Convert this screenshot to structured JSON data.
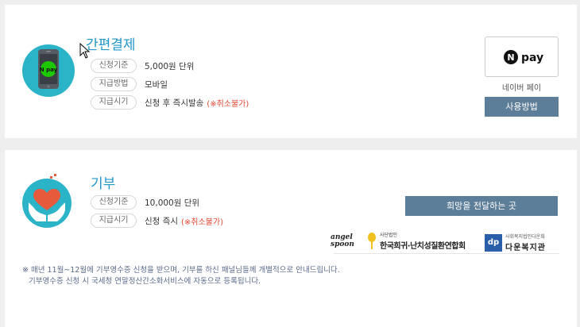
{
  "npay_card": {
    "title": "간편결제",
    "rows": [
      {
        "tag": "신청기준",
        "value": "5,000원 단위",
        "warn": ""
      },
      {
        "tag": "지급방법",
        "value": "모바일",
        "warn": ""
      },
      {
        "tag": "지급시기",
        "value": "신청 후 즉시발송",
        "warn": "(※취소불가)"
      }
    ],
    "logo_text": "pay",
    "logo_n": "N",
    "logo_label": "네이버 페이",
    "button": "사용방법"
  },
  "donate_card": {
    "title": "기부",
    "rows": [
      {
        "tag": "신청기준",
        "value": "10,000원 단위",
        "warn": ""
      },
      {
        "tag": "지급시기",
        "value": "신청 즉시",
        "warn": "(※취소불가)"
      }
    ],
    "button": "희망을 전달하는 곳",
    "partner1_script": "angel spoon",
    "partner1_org_sub": "사단법인",
    "partner1_org": "한국희귀·난치성질환연합회",
    "partner2_badge": "dp",
    "partner2_org_sub": "사회복지법인다운회",
    "partner2_org": "다운복지관",
    "notices": [
      "※ 매년 11월~12월에 기부영수증 신청을 받으며, 기부를 하신 패널님들께 개별적으로 안내드립니다.",
      "기부영수증 신청 시 국세청 연말정산간소화서비스에 자동으로 등록됩니다."
    ]
  },
  "colors": {
    "accent": "#2196c9",
    "button": "#5d7e99",
    "circle": "#2bb3c8",
    "warn": "#e0452f",
    "heart": "#e85a3c"
  }
}
